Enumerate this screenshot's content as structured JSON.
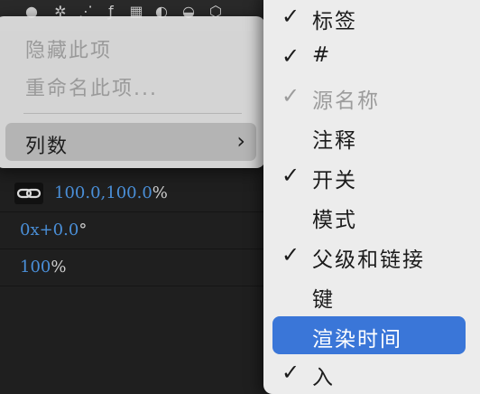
{
  "toolbar": {
    "icons": [
      "solo-icon",
      "star-icon",
      "shy-icon",
      "fx-icon",
      "film-icon",
      "circle-icon",
      "half-circle-icon",
      "cube-icon"
    ]
  },
  "rows": {
    "scale": "100.0,100.0",
    "scale_unit": "%",
    "rotation": "0x+0.0",
    "rotation_unit": "°",
    "opacity": "100",
    "opacity_unit": "%"
  },
  "context_menu": {
    "hide_item": "隐藏此项",
    "rename_item": "重命名此项...",
    "columns_item": "列数",
    "submenu_arrow": "›"
  },
  "columns_submenu": {
    "items": [
      {
        "label": "标签",
        "checked": true,
        "enabled": true
      },
      {
        "label": "#",
        "checked": true,
        "enabled": true
      },
      {
        "label": "源名称",
        "checked": true,
        "enabled": false
      },
      {
        "label": "注释",
        "checked": false,
        "enabled": true
      },
      {
        "label": "开关",
        "checked": true,
        "enabled": true
      },
      {
        "label": "模式",
        "checked": false,
        "enabled": true
      },
      {
        "label": "父级和链接",
        "checked": true,
        "enabled": true
      },
      {
        "label": "键",
        "checked": false,
        "enabled": true
      },
      {
        "label": "渲染时间",
        "checked": false,
        "enabled": true,
        "highlighted": true
      },
      {
        "label": "入",
        "checked": true,
        "enabled": true
      }
    ],
    "check_glyph": "✓"
  },
  "colors": {
    "value_blue": "#4a8fd8",
    "highlight": "#3a76d8"
  }
}
